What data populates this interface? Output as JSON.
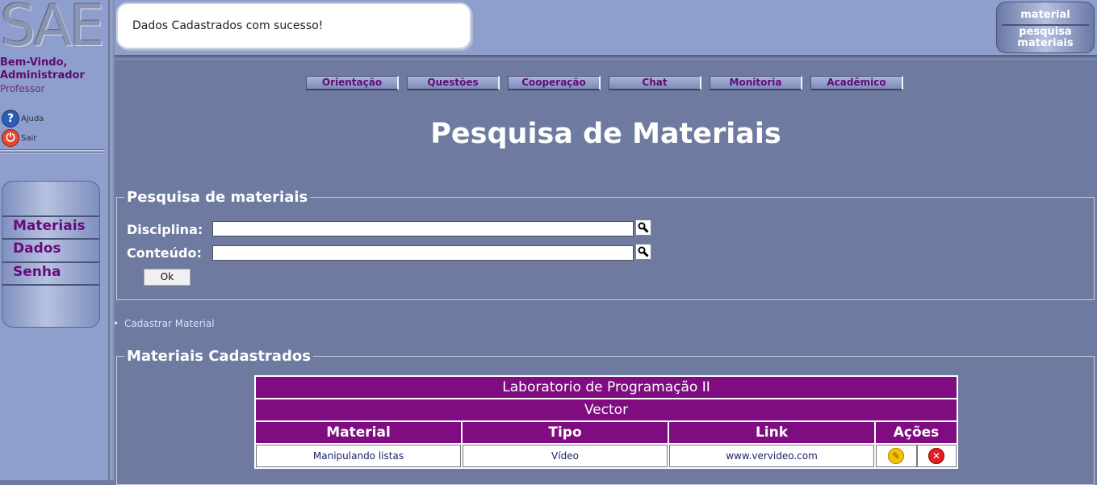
{
  "sidebar": {
    "logo": "SAE",
    "welcome_line1": "Bem-Vindo,",
    "welcome_line2": "Administrador",
    "role": "Professor",
    "help_label": "Ajuda",
    "exit_label": "Sair",
    "menu": [
      "Materiais",
      "Dados",
      "Senha"
    ]
  },
  "header": {
    "message": "Dados Cadastrados com sucesso!",
    "right_panel": [
      "material",
      "pesquisa materiais"
    ]
  },
  "nav": [
    "Orientação",
    "Questões",
    "Cooperação",
    "Chat",
    "Monitoria",
    "Acadêmico"
  ],
  "main": {
    "title": "Pesquisa de Materiais",
    "search": {
      "legend": "Pesquisa de materiais",
      "discipline_label": "Disciplina:",
      "discipline_value": "",
      "content_label": "Conteúdo:",
      "content_value": "",
      "ok_label": "Ok"
    },
    "register_link": "Cadastrar Material",
    "materials": {
      "legend": "Materiais Cadastrados",
      "course": "Laboratorio de Programação II",
      "topic": "Vector",
      "columns": [
        "Material",
        "Tipo",
        "Link",
        "Ações"
      ],
      "rows": [
        {
          "material": "Manipulando listas",
          "tipo": "Vídeo",
          "link": "www.vervideo.com"
        }
      ]
    }
  },
  "colors": {
    "page_bg": "#6e7a9f",
    "sidebar_bg": "#8f9fcd",
    "accent_purple": "#7f0c80",
    "menu_text": "#6a0a7e"
  }
}
